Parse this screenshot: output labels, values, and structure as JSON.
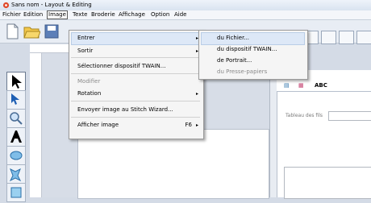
{
  "window": {
    "title": "Sans nom - Layout & Editing"
  },
  "menubar": {
    "items": [
      "Fichier",
      "Edition",
      "Image",
      "Texte",
      "Broderie",
      "Affichage",
      "Option",
      "Aide"
    ],
    "active": "Image"
  },
  "image_menu": {
    "items": [
      {
        "label": "Entrer",
        "submenu": true,
        "disabled": false,
        "shortcut": ""
      },
      {
        "label": "Sortir",
        "submenu": true,
        "disabled": false,
        "shortcut": ""
      },
      {
        "label": "Sélectionner dispositif TWAIN...",
        "submenu": false,
        "disabled": false,
        "shortcut": ""
      },
      {
        "label": "Modifier",
        "submenu": false,
        "disabled": true,
        "shortcut": ""
      },
      {
        "label": "Rotation",
        "submenu": true,
        "disabled": false,
        "shortcut": ""
      },
      {
        "label": "Envoyer image au Stitch Wizard...",
        "submenu": false,
        "disabled": false,
        "shortcut": ""
      },
      {
        "label": "Afficher image",
        "submenu": true,
        "disabled": false,
        "shortcut": "F6"
      }
    ],
    "arrow": "▸"
  },
  "entrer_submenu": {
    "items": [
      {
        "label": "du Fichier...",
        "disabled": false
      },
      {
        "label": "du dispositif TWAIN...",
        "disabled": false
      },
      {
        "label": "de Portrait...",
        "disabled": false
      },
      {
        "label": "du Presse-papiers",
        "disabled": true
      }
    ]
  },
  "right_panel": {
    "tab_text": "ABC",
    "thread_label": "Tableau des fils"
  },
  "colors": {
    "menu_highlight": "#dde8f7",
    "toolbar": "#e8edf4",
    "workspace": "#d7dde7"
  }
}
